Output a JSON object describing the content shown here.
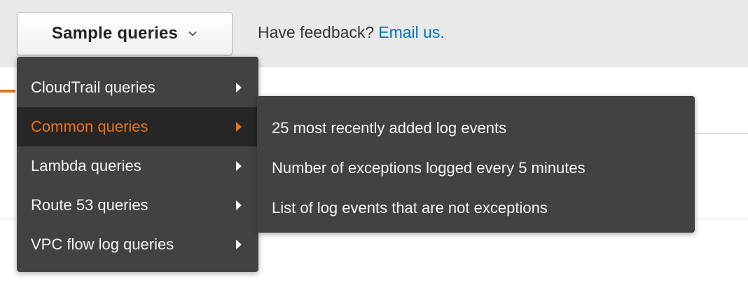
{
  "toolbar": {
    "sample_button_label": "Sample queries",
    "feedback_text": "Have feedback?",
    "feedback_link": "Email us."
  },
  "menu": {
    "items": [
      {
        "label": "CloudTrail queries",
        "active": false
      },
      {
        "label": "Common queries",
        "active": true
      },
      {
        "label": "Lambda queries",
        "active": false
      },
      {
        "label": "Route 53 queries",
        "active": false
      },
      {
        "label": "VPC flow log queries",
        "active": false
      }
    ]
  },
  "submenu": {
    "items": [
      {
        "label": "25 most recently added log events"
      },
      {
        "label": "Number of exceptions logged every 5 minutes"
      },
      {
        "label": "List of log events that are not exceptions"
      }
    ]
  },
  "colors": {
    "accent": "#ec7211",
    "link": "#0073bb",
    "menu_bg": "#424242",
    "menu_active_bg": "#262626",
    "toolbar_bg": "#e9e9e9"
  },
  "icons": {
    "dropdown": "chevron-down-icon",
    "submenu_arrow": "caret-right-icon"
  }
}
